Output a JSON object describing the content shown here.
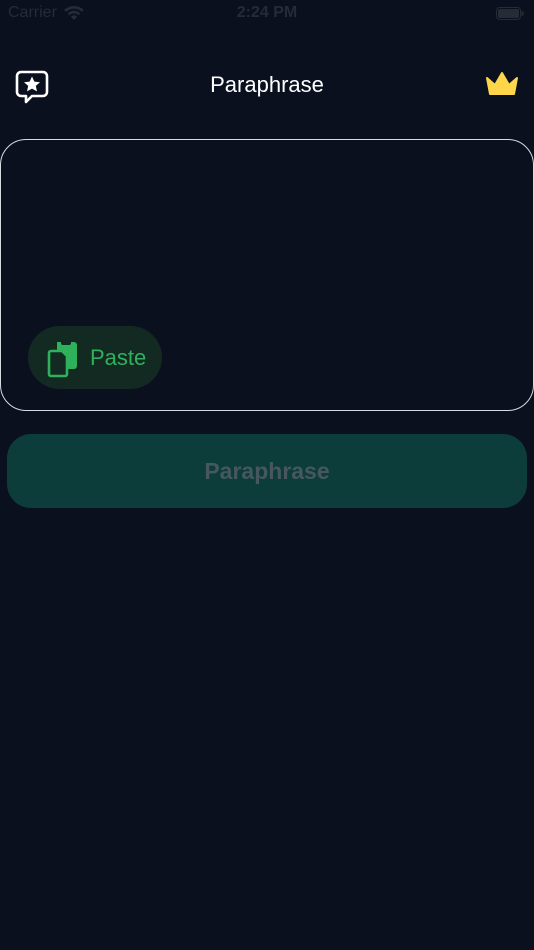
{
  "status_bar": {
    "carrier": "Carrier",
    "time": "2:24 PM"
  },
  "nav": {
    "title": "Paraphrase",
    "left_icon": "star-speech-bubble-icon",
    "right_icon": "crown-icon"
  },
  "input": {
    "value": "",
    "placeholder": ""
  },
  "paste_button": {
    "label": "Paste",
    "icon": "clipboard-icon"
  },
  "paraphrase_button": {
    "label": "Paraphrase"
  },
  "colors": {
    "background": "#0b101f",
    "crown": "#ffd54a",
    "paste_green": "#2fb15c",
    "paste_bg": "#132a22",
    "action_bg": "#0c3d3b",
    "action_text": "#46585d"
  }
}
